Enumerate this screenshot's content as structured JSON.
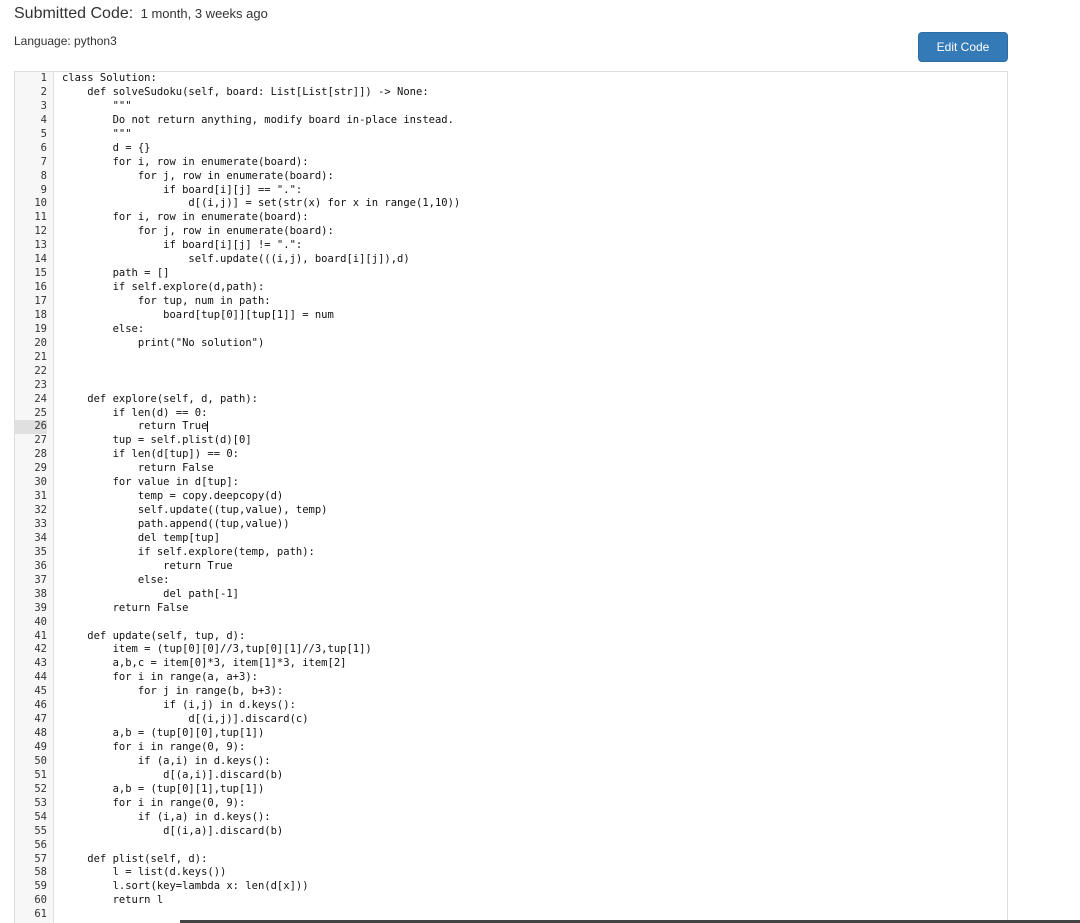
{
  "header": {
    "title": "Submitted Code:",
    "age": "1 month, 3 weeks ago",
    "language": "Language: python3",
    "edit_label": "Edit Code"
  },
  "editor": {
    "active_line": 26,
    "lines": [
      "class Solution:",
      "    def solveSudoku(self, board: List[List[str]]) -> None:",
      "        \"\"\"",
      "        Do not return anything, modify board in-place instead.",
      "        \"\"\"",
      "        d = {}",
      "        for i, row in enumerate(board):",
      "            for j, row in enumerate(board):",
      "                if board[i][j] == \".\":",
      "                    d[(i,j)] = set(str(x) for x in range(1,10))",
      "        for i, row in enumerate(board):",
      "            for j, row in enumerate(board):",
      "                if board[i][j] != \".\":",
      "                    self.update(((i,j), board[i][j]),d)",
      "        path = []",
      "        if self.explore(d,path):",
      "            for tup, num in path:",
      "                board[tup[0]][tup[1]] = num",
      "        else:",
      "            print(\"No solution\")",
      "",
      "",
      "",
      "    def explore(self, d, path):",
      "        if len(d) == 0:",
      "            return True",
      "        tup = self.plist(d)[0]",
      "        if len(d[tup]) == 0:",
      "            return False",
      "        for value in d[tup]:",
      "            temp = copy.deepcopy(d)",
      "            self.update((tup,value), temp)",
      "            path.append((tup,value))",
      "            del temp[tup]",
      "            if self.explore(temp, path):",
      "                return True",
      "            else:",
      "                del path[-1]",
      "        return False",
      "",
      "    def update(self, tup, d):",
      "        item = (tup[0][0]//3,tup[0][1]//3,tup[1])",
      "        a,b,c = item[0]*3, item[1]*3, item[2]",
      "        for i in range(a, a+3):",
      "            for j in range(b, b+3):",
      "                if (i,j) in d.keys():",
      "                    d[(i,j)].discard(c)",
      "        a,b = (tup[0][0],tup[1])",
      "        for i in range(0, 9):",
      "            if (a,i) in d.keys():",
      "                d[(a,i)].discard(b)",
      "        a,b = (tup[0][1],tup[1])",
      "        for i in range(0, 9):",
      "            if (i,a) in d.keys():",
      "                d[(i,a)].discard(b)",
      "",
      "    def plist(self, d):",
      "        l = list(d.keys())",
      "        l.sort(key=lambda x: len(d[x]))",
      "        return l",
      ""
    ]
  },
  "colors": {
    "button_bg": "#337ab7",
    "button_text": "#ffffff",
    "gutter_bg": "#f7f7f7",
    "active_line_gutter": "#e0e0e0"
  }
}
